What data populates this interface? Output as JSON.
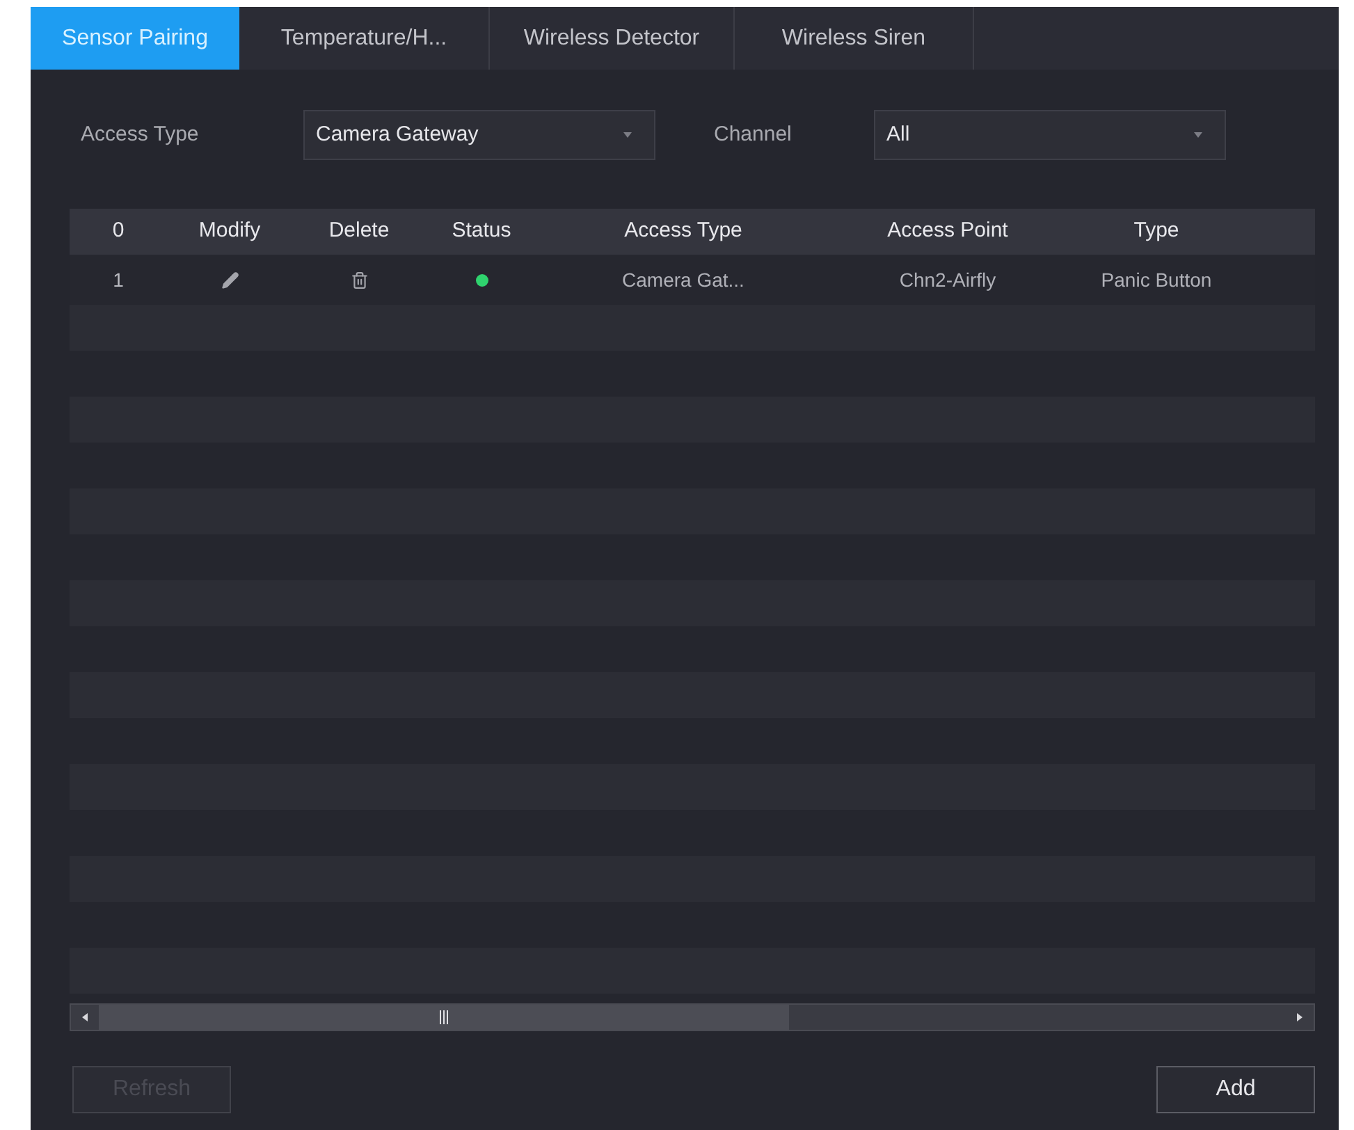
{
  "tabs": [
    {
      "label": "Sensor Pairing",
      "selected": true
    },
    {
      "label": "Temperature/H...",
      "selected": false
    },
    {
      "label": "Wireless Detector",
      "selected": false
    },
    {
      "label": "Wireless Siren",
      "selected": false
    }
  ],
  "filters": [
    {
      "label": "Access Type",
      "value": "Camera Gateway"
    },
    {
      "label": "Channel",
      "value": "All"
    }
  ],
  "table": {
    "columns": [
      "0",
      "Modify",
      "Delete",
      "Status",
      "Access Type",
      "Access Point",
      "Type"
    ],
    "rows": [
      {
        "number": "1",
        "online": true,
        "access_type": "Camera Gat...",
        "access_point": "Chn2-Airfly",
        "type": "Panic Button"
      }
    ]
  },
  "buttons": [
    {
      "label": "Refresh",
      "disabled": true
    },
    {
      "label": "Add",
      "disabled": false
    }
  ]
}
